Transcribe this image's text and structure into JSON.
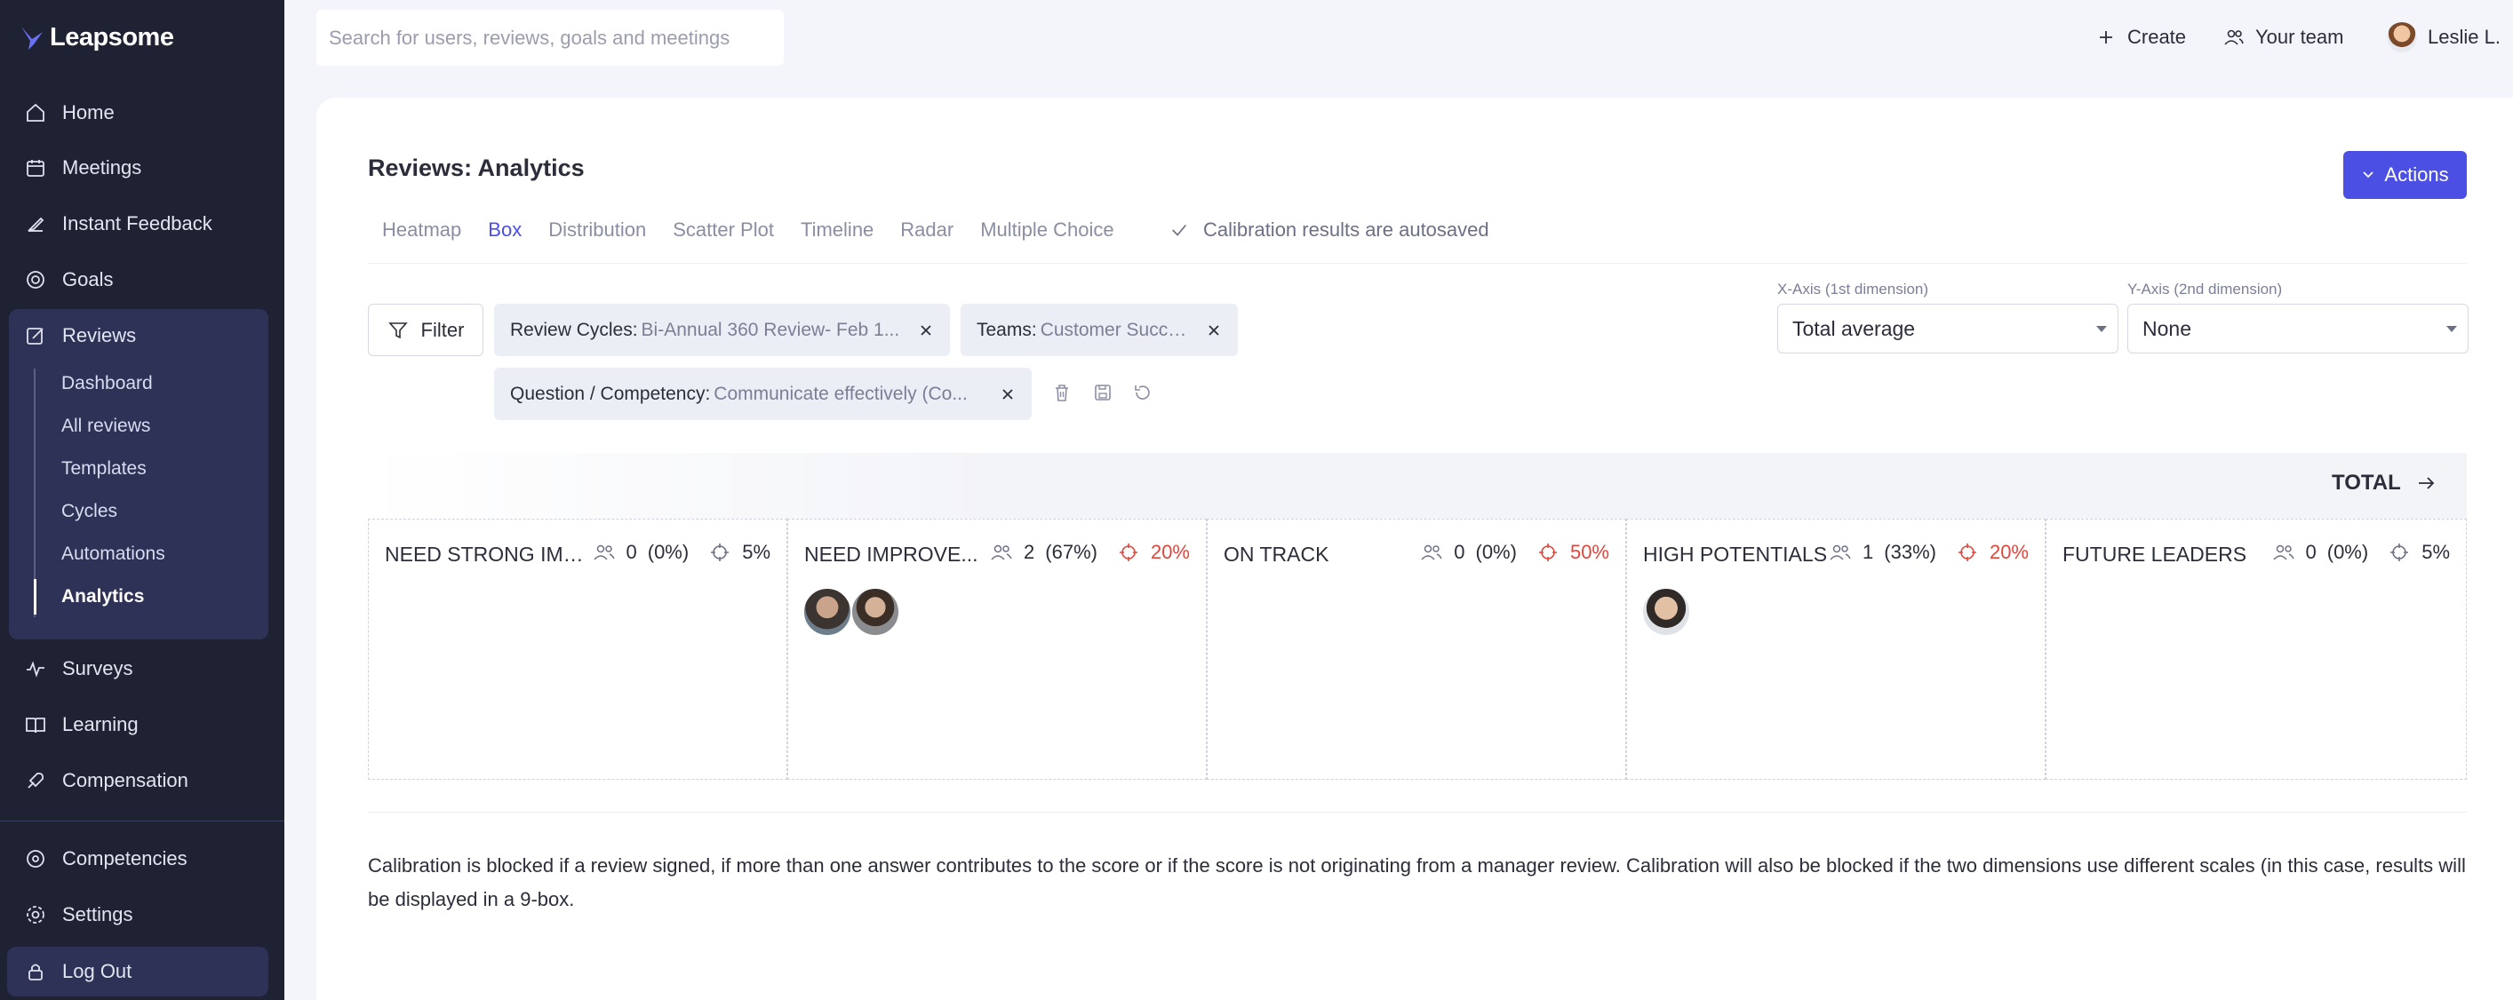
{
  "app": {
    "name": "Leapsome"
  },
  "sidebar": {
    "items": [
      {
        "label": "Home",
        "icon": "home-icon"
      },
      {
        "label": "Meetings",
        "icon": "meetings-icon"
      },
      {
        "label": "Instant Feedback",
        "icon": "feedback-icon"
      },
      {
        "label": "Goals",
        "icon": "goals-icon"
      },
      {
        "label": "Reviews",
        "icon": "reviews-icon"
      },
      {
        "label": "Surveys",
        "icon": "surveys-icon"
      },
      {
        "label": "Learning",
        "icon": "learning-icon"
      },
      {
        "label": "Compensation",
        "icon": "compensation-icon"
      },
      {
        "label": "Competencies",
        "icon": "competencies-icon"
      },
      {
        "label": "Settings",
        "icon": "settings-icon"
      },
      {
        "label": "Log Out",
        "icon": "lock-icon"
      }
    ],
    "reviews_sub": [
      "Dashboard",
      "All reviews",
      "Templates",
      "Cycles",
      "Automations",
      "Analytics"
    ],
    "active_sub": "Analytics"
  },
  "topbar": {
    "search_placeholder": "Search for users, reviews, goals and meetings",
    "create": "Create",
    "your_team": "Your team",
    "user_name": "Leslie L."
  },
  "page": {
    "title": "Reviews: Analytics",
    "actions": "Actions",
    "tabs": [
      "Heatmap",
      "Box",
      "Distribution",
      "Scatter Plot",
      "Timeline",
      "Radar",
      "Multiple Choice"
    ],
    "active_tab": "Box",
    "autosave": "Calibration results are autosaved"
  },
  "filters": {
    "filter_label": "Filter",
    "chips": [
      {
        "key": "Review Cycles:",
        "value": "Bi-Annual 360 Review- Feb 1..."
      },
      {
        "key": "Teams:",
        "value": "Customer Success"
      },
      {
        "key": "Question / Competency:",
        "value": "Communicate effectively (Co..."
      }
    ]
  },
  "axes": {
    "x_label": "X-Axis (1st dimension)",
    "x_value": "Total average",
    "y_label": "Y-Axis (2nd dimension)",
    "y_value": "None"
  },
  "grid": {
    "total_label": "TOTAL",
    "boxes": [
      {
        "title": "NEED STRONG IMP...",
        "count": "0",
        "pct": "(0%)",
        "target": "5%",
        "target_red": false,
        "avatars": 0
      },
      {
        "title": "NEED IMPROVE...",
        "count": "2",
        "pct": "(67%)",
        "target": "20%",
        "target_red": true,
        "avatars": 2
      },
      {
        "title": "ON TRACK",
        "count": "0",
        "pct": "(0%)",
        "target": "50%",
        "target_red": true,
        "avatars": 0
      },
      {
        "title": "HIGH POTENTIALS",
        "count": "1",
        "pct": "(33%)",
        "target": "20%",
        "target_red": true,
        "avatars": 1
      },
      {
        "title": "FUTURE LEADERS",
        "count": "0",
        "pct": "(0%)",
        "target": "5%",
        "target_red": false,
        "avatars": 0
      }
    ]
  },
  "note": "Calibration is blocked if a review signed, if more than one answer contributes to the score or if the score is not originating from a manager review. Calibration will also be blocked if the two dimensions use different scales (in this case, results will be displayed in a 9-box.",
  "colors": {
    "accent": "#4b4fe4",
    "sidebar": "#1f2233",
    "danger": "#e0463c"
  }
}
